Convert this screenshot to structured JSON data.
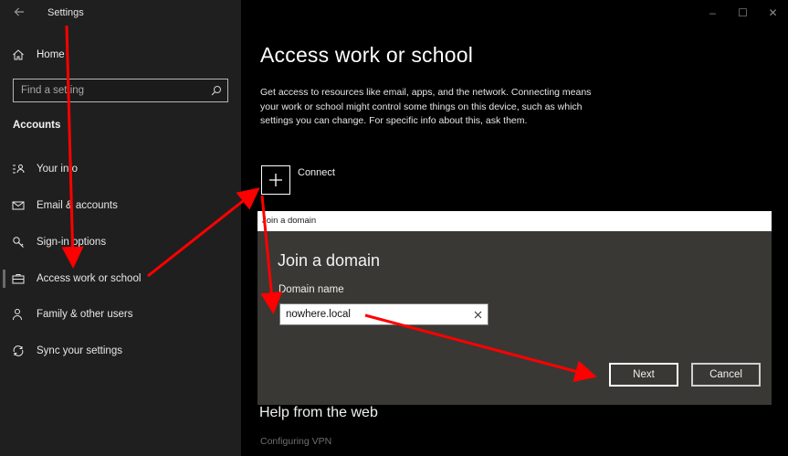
{
  "window": {
    "app_title": "Settings",
    "back_icon": "back-arrow-icon",
    "controls": {
      "minimize": "–",
      "maximize": "☐",
      "close": "✕"
    }
  },
  "sidebar": {
    "home_label": "Home",
    "search_placeholder": "Find a setting",
    "section_heading": "Accounts",
    "items": [
      {
        "label": "Your info",
        "icon": "person-card-icon"
      },
      {
        "label": "Email & accounts",
        "icon": "mail-icon"
      },
      {
        "label": "Sign-in options",
        "icon": "key-icon"
      },
      {
        "label": "Access work or school",
        "icon": "briefcase-icon",
        "active": true
      },
      {
        "label": "Family & other users",
        "icon": "people-icon"
      },
      {
        "label": "Sync your settings",
        "icon": "sync-icon"
      }
    ]
  },
  "main": {
    "title": "Access work or school",
    "description": "Get access to resources like email, apps, and the network. Connecting means your work or school might control some things on this device, such as which settings you can change. For specific info about this, ask them.",
    "connect_label": "Connect",
    "help_title": "Help from the web",
    "help_link": "Configuring VPN"
  },
  "dialog": {
    "window_title": "Join a domain",
    "heading": "Join a domain",
    "field_label": "Domain name",
    "field_value": "nowhere.local",
    "next_label": "Next",
    "cancel_label": "Cancel"
  },
  "colors": {
    "sidebar_bg": "#1f1f1f",
    "main_bg": "#000000",
    "dialog_bg": "#3a3834",
    "annotation_arrow": "#ff0000"
  }
}
